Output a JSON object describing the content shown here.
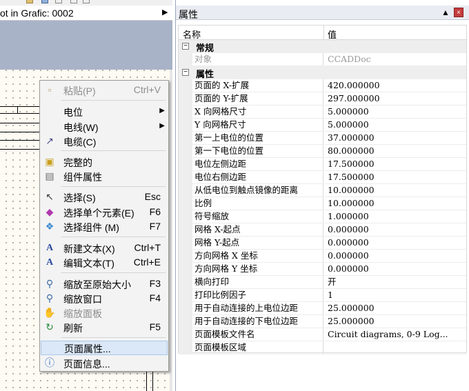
{
  "graphic_header": {
    "title": "ot in Grafic: 0002",
    "arrow_icon": "triangle-right-icon"
  },
  "context_menu": {
    "items": [
      {
        "label": "粘贴(P)",
        "shortcut": "Ctrl+V",
        "icon": "paste-icon",
        "disabled": true
      },
      {
        "label": "电位",
        "submenu": true
      },
      {
        "label": "电线(W)",
        "submenu": true
      },
      {
        "label": "电缆(C)",
        "icon": "cable-icon"
      },
      {
        "label": "完整的",
        "icon": "complete-icon"
      },
      {
        "label": "组件属性",
        "icon": "component-properties-icon"
      },
      {
        "label": "选择(S)",
        "shortcut": "Esc",
        "icon": "pointer-icon"
      },
      {
        "label": "选择单个元素(E)",
        "shortcut": "F6",
        "icon": "select-element-icon"
      },
      {
        "label": "选择组件 (M)",
        "shortcut": "F7",
        "icon": "select-component-icon"
      },
      {
        "label": "新建文本(X)",
        "shortcut": "Ctrl+T",
        "icon": "new-text-icon"
      },
      {
        "label": "编辑文本(T)",
        "shortcut": "Ctrl+E",
        "icon": "edit-text-icon"
      },
      {
        "label": "缩放至原始大小",
        "shortcut": "F3",
        "icon": "zoom-original-icon"
      },
      {
        "label": "缩放窗口",
        "shortcut": "F4",
        "icon": "zoom-window-icon"
      },
      {
        "label": "缩放面板",
        "icon": "hand-icon",
        "disabled": true
      },
      {
        "label": "刷新",
        "shortcut": "F5",
        "icon": "refresh-icon"
      },
      {
        "label": "页面属性...",
        "highlighted": true
      },
      {
        "label": "页面信息...",
        "icon": "page-info-icon"
      }
    ]
  },
  "properties_panel": {
    "title": "属性",
    "header": {
      "name": "名称",
      "value": "值"
    },
    "categories": [
      {
        "label": "常规",
        "toggle": "−"
      },
      {
        "label": "属性",
        "toggle": "−"
      }
    ],
    "general_rows": [
      {
        "name": "对象",
        "value": "CCADDoc"
      }
    ],
    "property_rows": [
      {
        "name": "页面的 X-扩展",
        "value": "420.000000"
      },
      {
        "name": "页面的 Y-扩展",
        "value": "297.000000"
      },
      {
        "name": "X 向网格尺寸",
        "value": "5.000000"
      },
      {
        "name": "Y 向网格尺寸",
        "value": "5.000000"
      },
      {
        "name": "第一上电位的位置",
        "value": "37.000000"
      },
      {
        "name": "第一下电位的位置",
        "value": "80.000000"
      },
      {
        "name": "电位左侧边距",
        "value": "17.500000"
      },
      {
        "name": "电位右侧边距",
        "value": "17.500000"
      },
      {
        "name": "从低电位到触点镜像的距离",
        "value": "10.000000"
      },
      {
        "name": "比例",
        "value": "10.000000"
      },
      {
        "name": "符号缩放",
        "value": "1.000000"
      },
      {
        "name": "网格 X-起点",
        "value": "0.000000"
      },
      {
        "name": "网格 Y-起点",
        "value": "0.000000"
      },
      {
        "name": "方向网格 X 坐标",
        "value": "0.000000"
      },
      {
        "name": "方向网格 Y 坐标",
        "value": "0.000000"
      },
      {
        "name": "横向打印",
        "value": "开"
      },
      {
        "name": "打印比例因子",
        "value": "1"
      },
      {
        "name": "用于自动连接的上电位边距",
        "value": "25.000000"
      },
      {
        "name": "用于自动连接的下电位边距",
        "value": "25.000000"
      },
      {
        "name": "页面模板文件名",
        "value": "Circuit diagrams, 0-9 Log..."
      },
      {
        "name": "页面模板区域",
        "value": ""
      }
    ]
  }
}
